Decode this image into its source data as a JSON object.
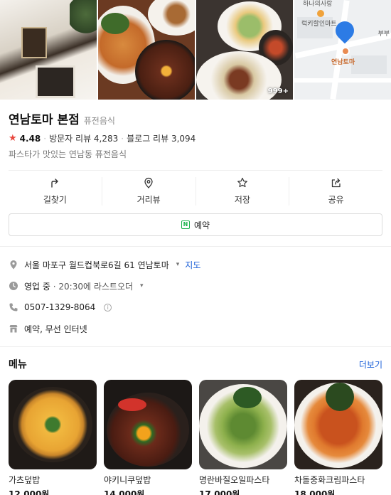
{
  "gallery": {
    "photo_count_badge": "999+",
    "map_labels": {
      "mart": "럭키할인마트",
      "pin": "연남토마",
      "top": "하나의사랑",
      "right": "부부"
    }
  },
  "place": {
    "name": "연남토마 본점",
    "category": "퓨전음식",
    "rating": "4.48",
    "visitor_reviews": "방문자 리뷰 4,283",
    "blog_reviews": "블로그 리뷰 3,094",
    "description": "파스타가 맛있는 연남동 퓨전음식"
  },
  "actions": [
    {
      "label": "길찾기",
      "icon": "directions-icon"
    },
    {
      "label": "거리뷰",
      "icon": "map-pin-icon"
    },
    {
      "label": "저장",
      "icon": "star-outline-icon"
    },
    {
      "label": "공유",
      "icon": "share-icon"
    }
  ],
  "reserve": {
    "label": "예약",
    "icon": "naver-n"
  },
  "details": {
    "address": "서울 마포구 월드컵북로6길 61 연남토마",
    "map_link": "지도",
    "hours_status": "영업 중",
    "hours_detail": " · 20:30에 라스트오더",
    "phone": "0507-1329-8064",
    "facilities": "예약, 무선 인터넷"
  },
  "menu": {
    "title": "메뉴",
    "more": "더보기",
    "items": [
      {
        "name": "가츠덮밥",
        "price": "12,000원"
      },
      {
        "name": "야키니쿠덮밥",
        "price": "14,000원"
      },
      {
        "name": "명란바질오일파스타",
        "price": "17,000원"
      },
      {
        "name": "차돌중화크림파스타",
        "price": "18,000원"
      }
    ]
  },
  "colors": {
    "accent_blue": "#1a5fd8",
    "star_red": "#e8473d",
    "naver_green": "#19b34a"
  }
}
